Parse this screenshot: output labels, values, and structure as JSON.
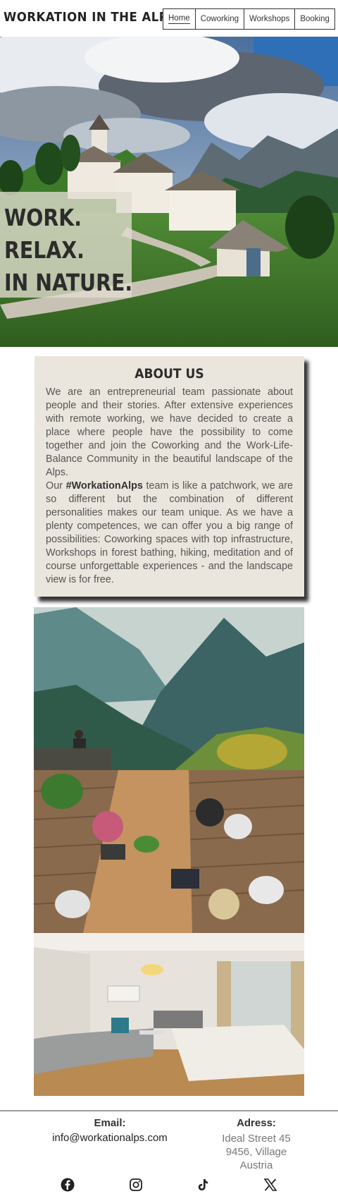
{
  "header": {
    "brand": "WORKATION IN THE ALPS",
    "nav": [
      {
        "label": "Home",
        "active": true
      },
      {
        "label": "Coworking",
        "active": false
      },
      {
        "label": "Workshops",
        "active": false
      },
      {
        "label": "Booking",
        "active": false
      }
    ]
  },
  "hero": {
    "lines": [
      "WORK.",
      "RELAX.",
      "IN NATURE."
    ]
  },
  "about": {
    "title": "ABOUT US",
    "paragraph1": "We are an entrepreneurial team passionate about people and their stories. After extensive experiences with remote working, we have decided to create a place where people have the possibility to come together and join the Coworking and the Work-Life-Balance Community in the beautiful landscape of the Alps.",
    "paragraph2_prefix": "Our ",
    "paragraph2_bold": "#WorkationAlps",
    "paragraph2_rest": " team is like a patchwork, we are so different but the combination of different personalities makes our team unique. As we have a plenty competences, we can offer you a big range of possibilities: Coworking spaces with top infrastructure, Workshops in forest bathing, hiking, meditation and of course unforgettable experiences - and the landscape view is for free."
  },
  "footer": {
    "email_title": "Email:",
    "email_value": "info@workationalps.com",
    "address_title": "Adress:",
    "address_line1": "Ideal Street 45",
    "address_line2": "9456, Village",
    "address_line3": "Austria",
    "social": [
      "facebook-icon",
      "instagram-icon",
      "tiktok-icon",
      "x-icon"
    ]
  }
}
